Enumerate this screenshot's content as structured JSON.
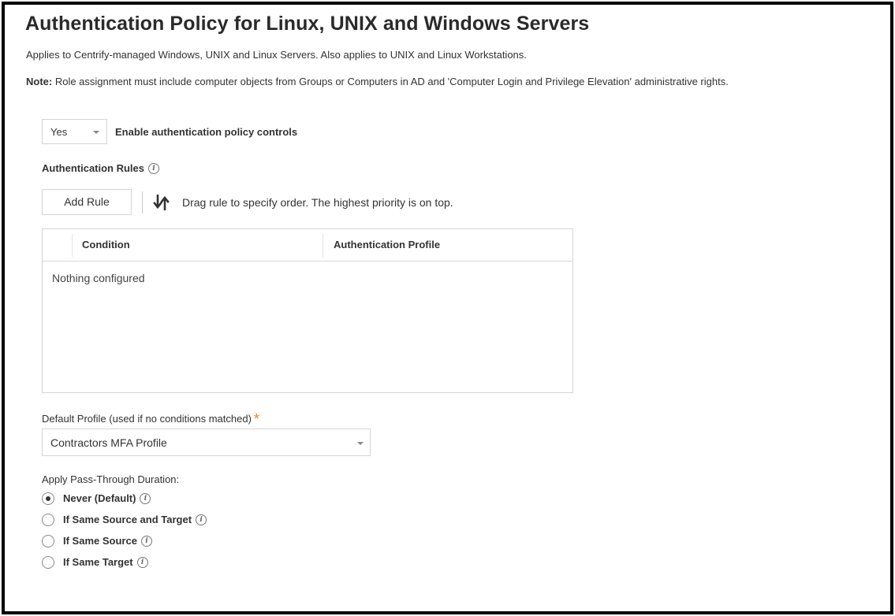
{
  "page": {
    "title": "Authentication Policy for Linux, UNIX and Windows Servers",
    "subtitle": "Applies to Centrify-managed Windows, UNIX and Linux Servers. Also applies to UNIX and Linux Workstations.",
    "note_label": "Note:",
    "note_text": " Role assignment must include computer objects from Groups or Computers in AD and 'Computer Login and Privilege Elevation' administrative rights."
  },
  "enable": {
    "selected": "Yes",
    "label": "Enable authentication policy controls"
  },
  "rules": {
    "label": "Authentication Rules",
    "add_button": "Add Rule",
    "drag_hint": "Drag rule to specify order. The highest priority is on top.",
    "columns": [
      "Condition",
      "Authentication Profile"
    ],
    "empty_text": "Nothing configured"
  },
  "default_profile": {
    "label": "Default Profile (used if no conditions matched)",
    "required_mark": "*",
    "selected": "Contractors MFA Profile"
  },
  "pass_through": {
    "label": "Apply Pass-Through Duration:",
    "options": [
      {
        "label": "Never (Default)",
        "checked": true
      },
      {
        "label": "If Same Source and Target",
        "checked": false
      },
      {
        "label": "If Same Source",
        "checked": false
      },
      {
        "label": "If Same Target",
        "checked": false
      }
    ]
  },
  "colors": {
    "required": "#f57c1f",
    "border": "#d6d6d6",
    "text": "#333333"
  }
}
